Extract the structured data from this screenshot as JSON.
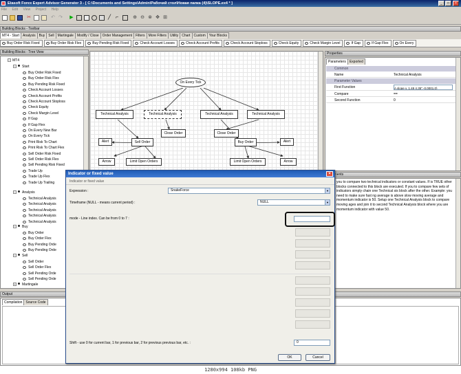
{
  "app": {
    "title": "Etasoft Forex Expert Advisor Generator 3 - [ C:\\Documents and Settings\\Admin\\Рабочий стол\\Новая папка (4)\\SLOPE.ex4 * ]",
    "minimize": "_",
    "maximize": "□",
    "close": "×"
  },
  "menu": [
    "File",
    "Edit",
    "View",
    "Project",
    "Help"
  ],
  "building_blocks_toolbar_title": "Building Blocks - Toolbar",
  "tabs": [
    "MT4 - Start",
    "Analysis",
    "Buy",
    "Sell",
    "Martingale",
    "Modify / Close",
    "Order Management",
    "Filters",
    "More Filters",
    "Utility",
    "Chart",
    "Custom",
    "Your Blocks"
  ],
  "block_buttons": [
    "Buy Order Risk Fixed",
    "Buy Order Risk Flex",
    "Buy Pending Risk Fixed",
    "Check Account Losses",
    "Check Account Profits",
    "Check Account Stoploss",
    "Check Equity",
    "Check Margin Level",
    "If Gap",
    "If Gap Flex",
    "On Every"
  ],
  "tree": {
    "title": "Building Blocks - Tree View",
    "root": "MT4",
    "start": "Start",
    "start_items": [
      "Buy Order Risk Fixed",
      "Buy Order Risk Flex",
      "Buy Pending Risk Fixed",
      "Check Account Losses",
      "Check Account Profits",
      "Check Account Stoploss",
      "Check Equity",
      "Check Margin Level",
      "If Gap",
      "If Gap Flex",
      "On Every New Bar",
      "On Every Tick",
      "Print Risk To Chart",
      "Print Risk To Chart Flex",
      "Sell Order Risk Fixed",
      "Sell Order Risk Flex",
      "Sell Pending Risk Fixed",
      "Trade Up",
      "Trade Up Flex",
      "Trade Up Trailing"
    ],
    "analysis": "Analysis",
    "analysis_items": [
      "Technical Analysis",
      "Technical Analysis",
      "Technical Analysis",
      "Technical Analysis",
      "Technical Analysis"
    ],
    "buy": "Buy",
    "buy_items": [
      "Buy Order",
      "Buy Order Flex",
      "Buy Pending Orde",
      "Buy Pending Orde"
    ],
    "sell": "Sell",
    "sell_items": [
      "Sell Order",
      "Sell Order Flex",
      "Sell Pending Orde",
      "Sell Pending Orde"
    ],
    "martingale": "Martingale"
  },
  "diagram": {
    "on_every_tick": "On Every Tick",
    "ta1": "Technical Analysis",
    "ta2": "Technical Analysis",
    "ta3": "Technical Analysis",
    "ta4": "Technical Analysis",
    "close1": "Close Order",
    "close2": "Close Order",
    "alert1": "Alert",
    "alert2": "Alert",
    "sell_order": "Sell Order",
    "buy_order": "Buy Order",
    "arrow1": "Arrow",
    "arrow2": "Arrow",
    "limit1": "Limit Open Orders",
    "limit2": "Limit Open Orders"
  },
  "properties": {
    "title": "Properties",
    "tabs": [
      "Parameters",
      "Exported"
    ],
    "common": "Common",
    "name_label": "Name",
    "name_value": "Technical Analysis",
    "param_values": "Parameter Values",
    "first_function_label": "First Function",
    "first_function_value": "A slope v. 1.48 4.35\",-0.0001,0)",
    "compare_label": "Compare",
    "compare_value": "==",
    "second_function_label": "Second Function",
    "second_function_value": "0"
  },
  "comments": {
    "title": "Comments",
    "text": "you to compare two technical indicators or constant values. If is TRUE other blocks connected to this block are executed. If you to compare few sets of indicators simply chain one Technical sis block after the other. Example: you need to make sure fast ng average is above slow moving average and momentum indicator is 50. Setup one Technical Analysis block to compare moving ages and join it to second Technical Analysis block where you are momentum indicator with value 50."
  },
  "output": {
    "title": "Output",
    "tabs": [
      "Compilation",
      "Source Code"
    ]
  },
  "dialog": {
    "title": "Indicator or fixed value",
    "subtitle": "Indicator or fixed value",
    "expression_label": "Expression :",
    "expression_value": "SnakeForce",
    "timeframe_label": "Timeframe (NULL - means current period) :",
    "timeframe_value": "NULL",
    "mode_label": "mode - Line index. Can be from 0 to 7 :",
    "mode_value": "",
    "shift_label": "Shift - use 0 for current bar, 1 for previous bar, 2 for previous previous bar, etc. :",
    "shift_value": "0",
    "ok": "OK",
    "cancel": "Cancel"
  },
  "statusbar": "1280x994 108kb PNG"
}
